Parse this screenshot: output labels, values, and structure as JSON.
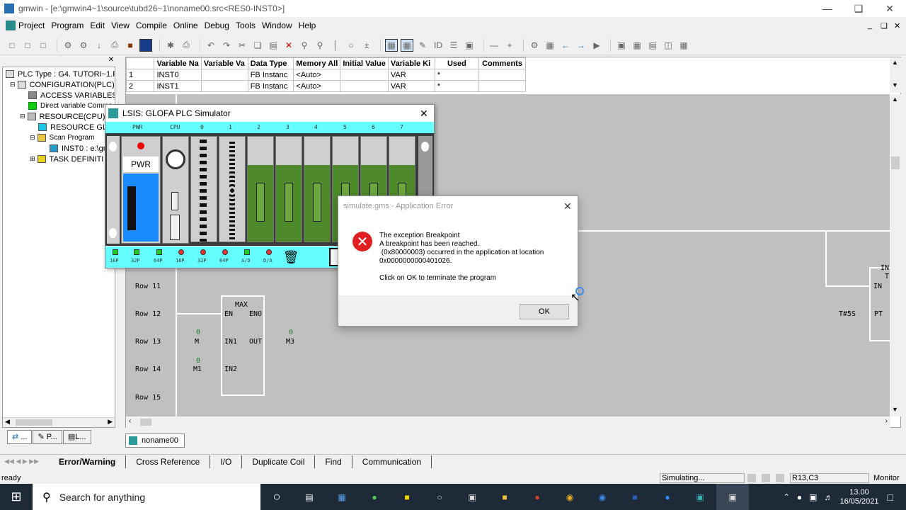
{
  "window": {
    "title": "gmwin - [e:\\gmwin4~1\\source\\tubd26~1\\noname00.src<RES0-INST0>]"
  },
  "menu": [
    "Project",
    "Program",
    "Edit",
    "View",
    "Compile",
    "Online",
    "Debug",
    "Tools",
    "Window",
    "Help"
  ],
  "tree": {
    "items": [
      "PLC Type : G4. TUTORI~1.F",
      "CONFIGURATION(PLC)",
      "ACCESS VARIABLES",
      "Direct variable Comme",
      "RESOURCE(CPU)",
      "RESOURCE GL",
      "Scan Program",
      "INST0 : e:\\gm",
      "TASK DEFINITI"
    ],
    "tabs": [
      "...",
      "P...",
      "L..."
    ]
  },
  "vargrid": {
    "headers": [
      "",
      "Variable Na",
      "Variable Va",
      "Data Type",
      "Memory All",
      "Initial Value",
      "Variable Ki",
      "Used",
      "Comments"
    ],
    "rows": [
      [
        "1",
        "INST0",
        "",
        "FB Instanc",
        "<Auto>",
        "",
        "VAR",
        "*",
        ""
      ],
      [
        "2",
        "INST1",
        "",
        "FB Instanc",
        "<Auto>",
        "",
        "VAR",
        "*",
        ""
      ]
    ]
  },
  "ladder": {
    "rows": [
      "Row 11",
      "Row 12",
      "Row 13",
      "Row 14",
      "Row 15"
    ],
    "block": {
      "name": "MAX",
      "en": "EN",
      "eno": "ENO",
      "in1": "IN1",
      "out": "OUT",
      "in2": "IN2"
    },
    "contacts": {
      "m": "M",
      "m1": "M1",
      "m3": "M3",
      "m_val": "0",
      "m1_val": "0",
      "m3_val": "0"
    },
    "timer": {
      "pt": "T#5S",
      "pt_pin": "PT",
      "in_pin": "IN",
      "in_a": "IN",
      "in_b": "T"
    }
  },
  "doctab": "noname00",
  "output_tabs": [
    "Error/Warning",
    "Cross Reference",
    "I/O",
    "Duplicate Coil",
    "Find",
    "Communication"
  ],
  "status": {
    "left": "ready",
    "sim": "Simulating...",
    "pos": "R13,C3",
    "mode": "Monitor"
  },
  "simulator": {
    "title": "LSIS: GLOFA PLC Simulator",
    "slots": [
      "PWR",
      "CPU",
      "0",
      "1",
      "2",
      "3",
      "4",
      "5",
      "6",
      "7"
    ],
    "pwr_label": "PWR",
    "leds": [
      "16P",
      "32P",
      "64P",
      "16P",
      "32P",
      "64P",
      "A/D",
      "D/A"
    ]
  },
  "error_dialog": {
    "title": "simulate.gms - Application Error",
    "message": "The exception Breakpoint\nA breakpoint has been reached.\n (0x80000003) occurred in the application at location\n0x0000000000401026.\n\nClick on OK to terminate the program",
    "ok": "OK"
  },
  "taskbar": {
    "search_placeholder": "Search for anything",
    "time": "13.00",
    "date": "16/05/2021"
  },
  "colors": {
    "accent": "#1f2a38",
    "sim_bar": "#66ffff",
    "error_red": "#e02020",
    "module_green": "#4e8a2c"
  }
}
